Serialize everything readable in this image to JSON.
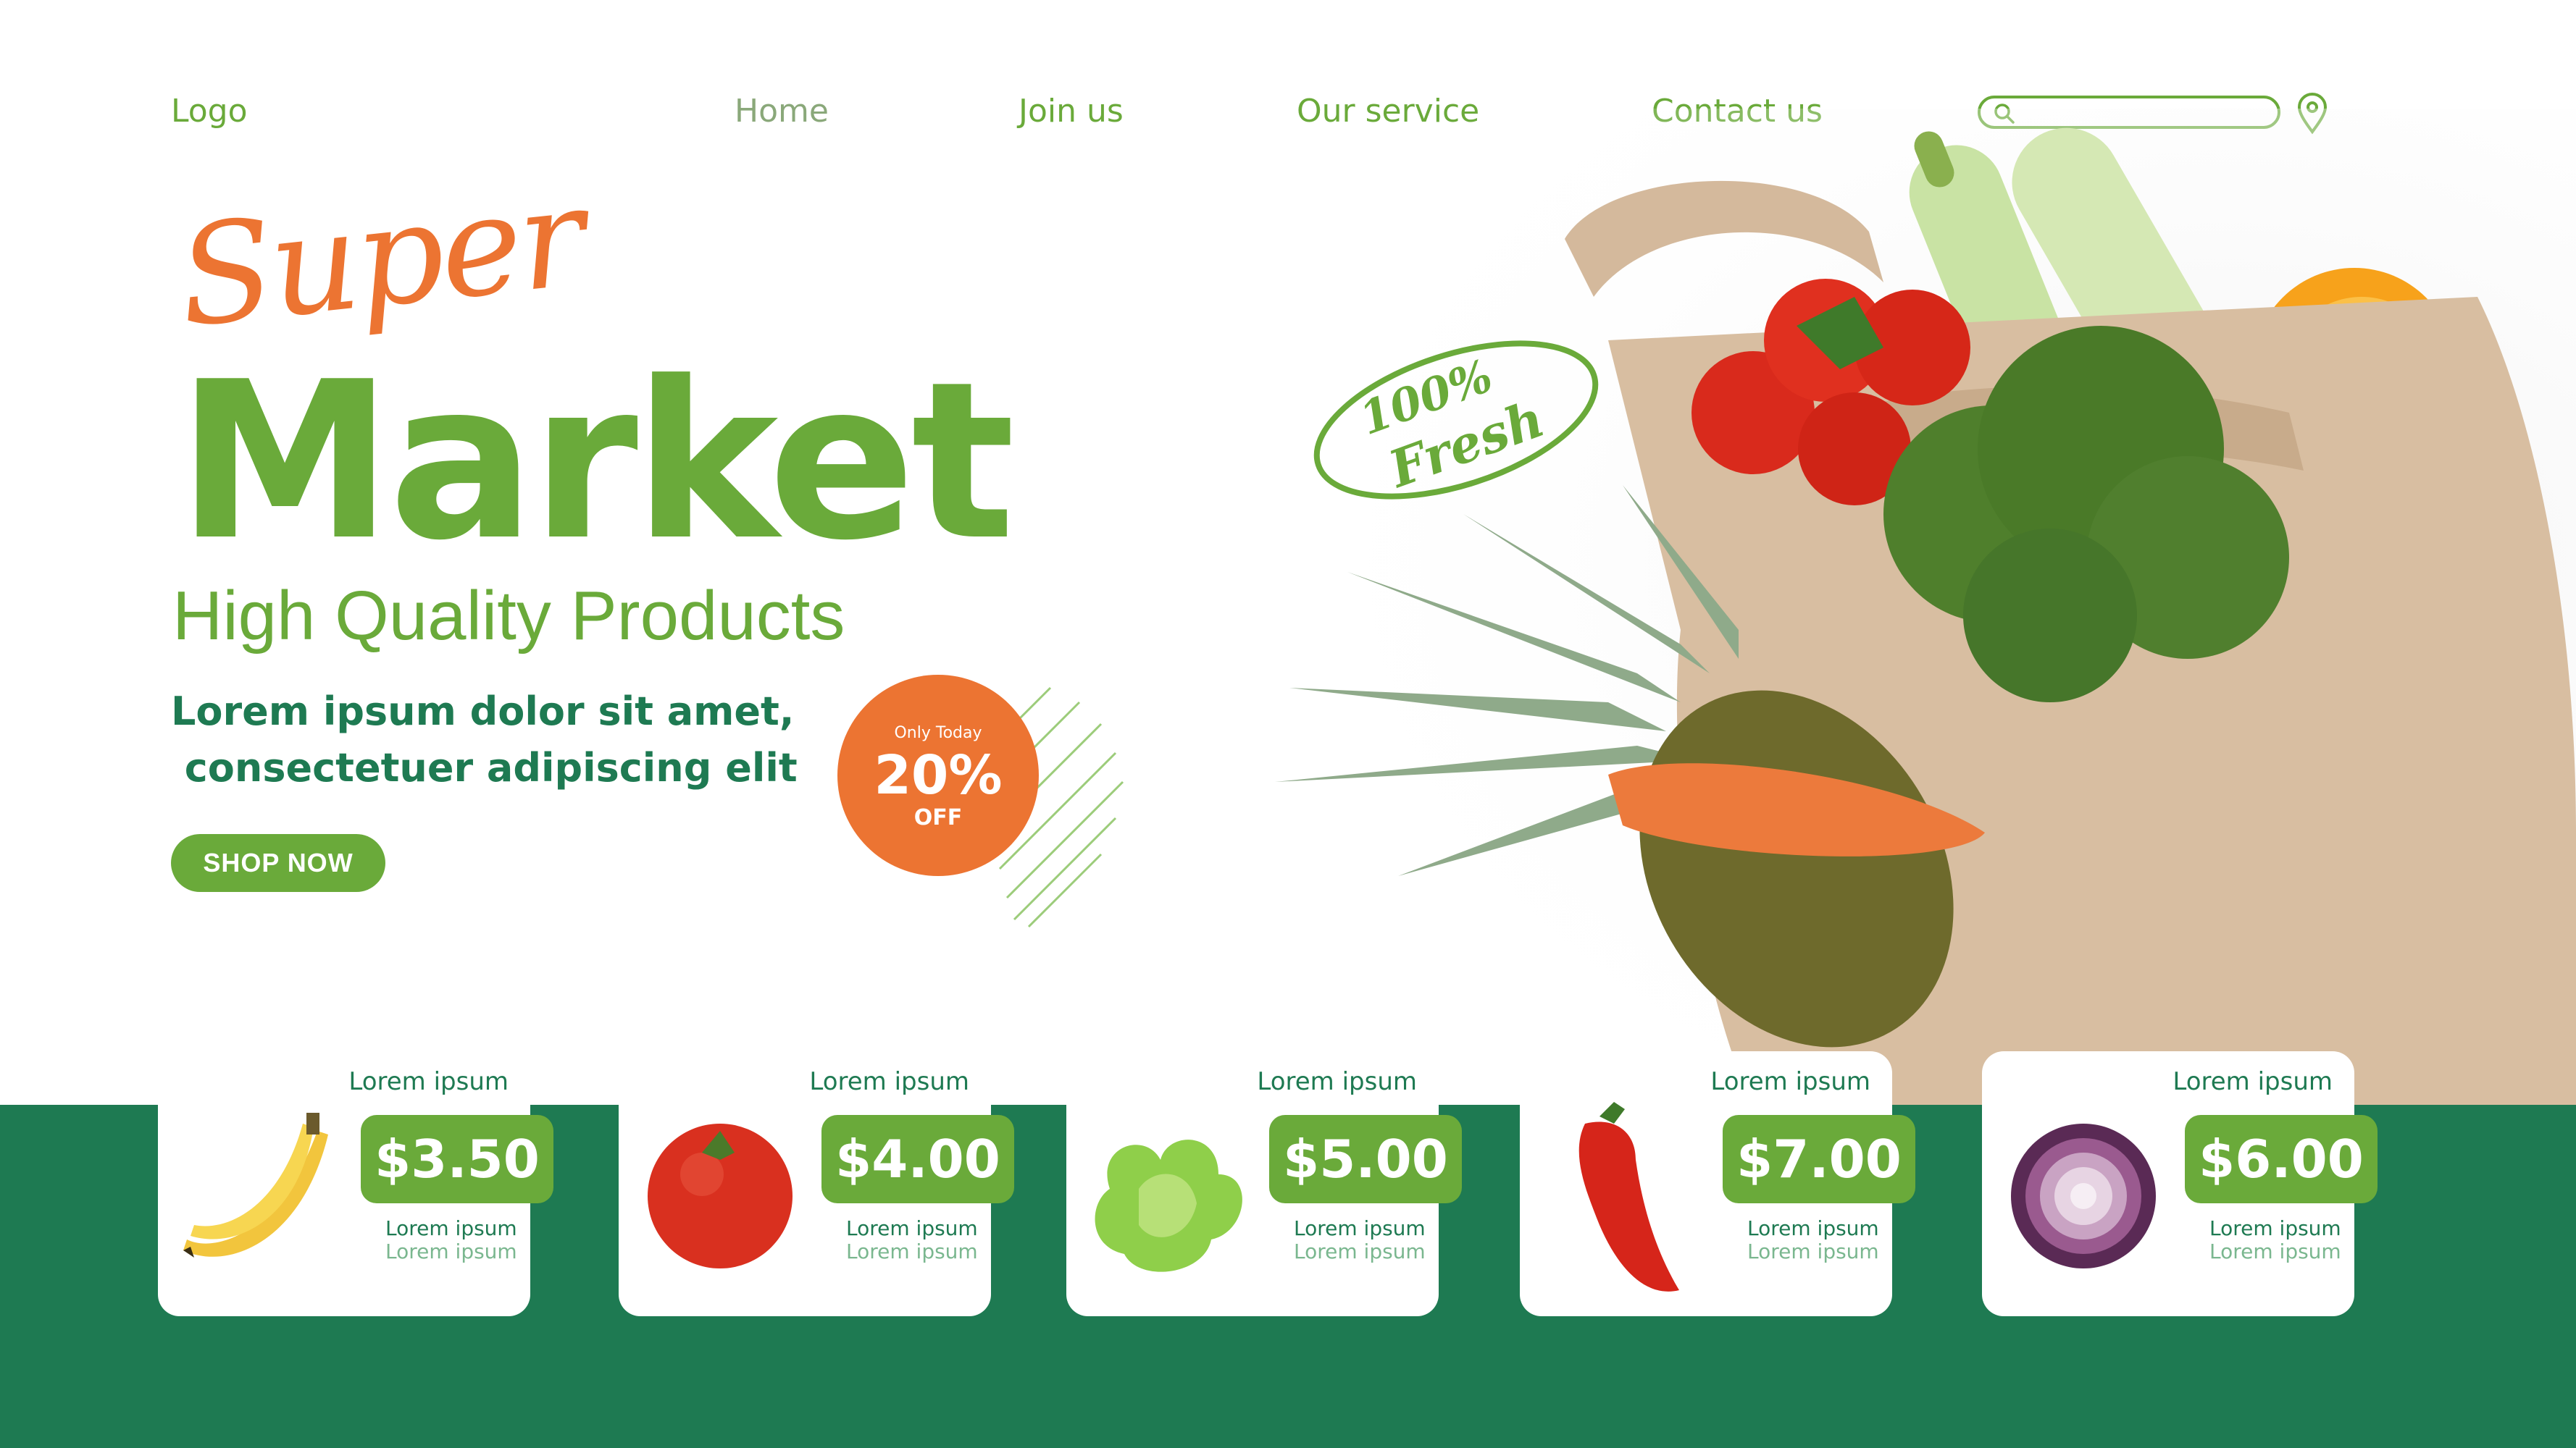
{
  "nav": {
    "logo": "Logo",
    "links": [
      "Home",
      "Join us",
      "Our service",
      "Contact us"
    ],
    "search_placeholder": ""
  },
  "hero": {
    "super": "Super",
    "market": "Market",
    "tagline": "High Quality Products",
    "desc_line1": "Lorem ipsum dolor sit amet,",
    "desc_line2": " consectetuer adipiscing elit",
    "cta": "SHOP NOW",
    "stamp": [
      "100%",
      "Fresh"
    ]
  },
  "discount": {
    "line1": "Only Today",
    "line2": "20%",
    "line3": "OFF"
  },
  "products": [
    {
      "name": "Lorem ipsum",
      "price": "$3.50",
      "sub1": "Lorem ipsum",
      "sub2": "Lorem ipsum",
      "icon": "banana-icon"
    },
    {
      "name": "Lorem ipsum",
      "price": "$4.00",
      "sub1": "Lorem ipsum",
      "sub2": "Lorem ipsum",
      "icon": "tomato-icon"
    },
    {
      "name": "Lorem ipsum",
      "price": "$5.00",
      "sub1": "Lorem ipsum",
      "sub2": "Lorem ipsum",
      "icon": "lettuce-icon"
    },
    {
      "name": "Lorem ipsum",
      "price": "$7.00",
      "sub1": "Lorem ipsum",
      "sub2": "Lorem ipsum",
      "icon": "pepper-icon"
    },
    {
      "name": "Lorem ipsum",
      "price": "$6.00",
      "sub1": "Lorem ipsum",
      "sub2": "Lorem ipsum",
      "icon": "onion-icon"
    }
  ],
  "colors": {
    "brand_green": "#6aaa3a",
    "dark_green": "#1e7a52",
    "accent_orange": "#ec7432"
  }
}
